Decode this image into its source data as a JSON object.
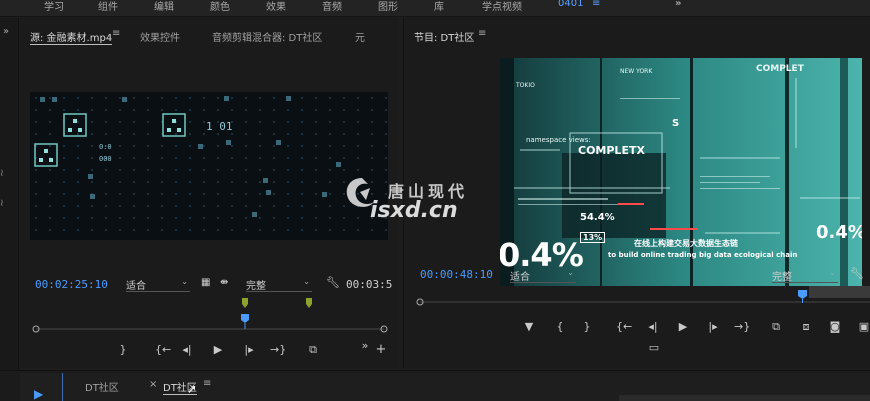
{
  "workspaces": {
    "items": [
      "学习",
      "组件",
      "编辑",
      "颜色",
      "效果",
      "音频",
      "图形",
      "库",
      "学点视频"
    ],
    "active": "0401",
    "more": "»"
  },
  "source_panel": {
    "tabs": [
      "源: 金融素材.mp4",
      "效果控件",
      "音频剪辑混合器: DT社区",
      "元"
    ],
    "timecode_in": "00:02:25:10",
    "zoom": "适合",
    "quality": "完整",
    "timecode_duration": "00:03:5",
    "video_text": {
      "digits_a": "1 01",
      "digits_b": "0:0",
      "digits_c": "000"
    }
  },
  "program_panel": {
    "title": "节目: DT社区",
    "timecode": "00:00:48:10",
    "zoom": "适合",
    "quality": "完整",
    "video_text": {
      "tokyo": "TOKIO",
      "new_york": "NEW YORK",
      "completx_top": "COMPLET",
      "namespace": "namespace views:",
      "completx_mid": "COMPLETX",
      "pct_54": "54.4%",
      "pct_13": "13%",
      "pct_big": "0.4%",
      "pct_right": "0.4%",
      "letter_s": "S",
      "caption_cn": "在线上构建交易大数据生态链",
      "caption_en": "to build online trading big data ecological chain"
    }
  },
  "watermark": {
    "cn": "唐山现代",
    "en": "isxd.cn"
  },
  "timeline_panel": {
    "tabs": [
      "DT社区",
      "DT社区"
    ],
    "close": "×"
  },
  "colors": {
    "accent": "#4a9bff",
    "panel_bg": "#1b1b1b",
    "teal": "#2f8f8c"
  }
}
